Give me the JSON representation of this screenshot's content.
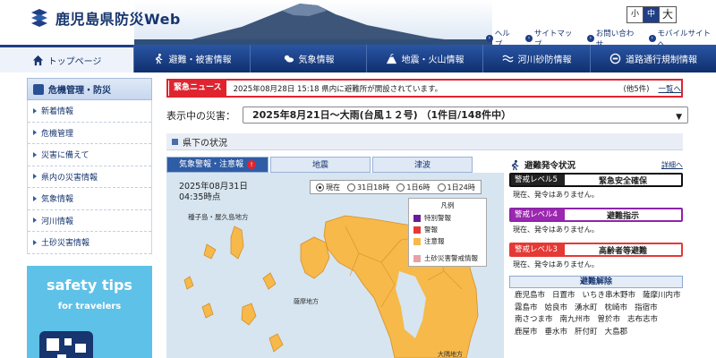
{
  "header": {
    "site_title": "鹿児島県防災Web",
    "font_size": {
      "small": "小",
      "medium": "中",
      "large": "大",
      "selected": "中"
    },
    "links": [
      "ヘルプ",
      "サイトマップ",
      "お問い合わせ",
      "モバイルサイトへ"
    ]
  },
  "nav": {
    "items": [
      {
        "label": "トップページ",
        "icon": "home-icon"
      },
      {
        "label": "避難・被害情報",
        "icon": "running-person-icon"
      },
      {
        "label": "気象情報",
        "icon": "weather-icon"
      },
      {
        "label": "地震・火山情報",
        "icon": "volcano-icon"
      },
      {
        "label": "河川砂防情報",
        "icon": "wave-icon"
      },
      {
        "label": "道路通行規制情報",
        "icon": "road-sign-icon"
      }
    ],
    "active_index": 0
  },
  "sidebar": {
    "heading": "危機管理・防災",
    "items": [
      "新着情報",
      "危機管理",
      "災害に備えて",
      "県内の災害情報",
      "気象情報",
      "河川情報",
      "土砂災害情報"
    ],
    "banner": {
      "line1": "safety tips",
      "line2": "for travelers"
    }
  },
  "news": {
    "tag": "緊急ニュース",
    "text": "2025年08月28日 15:18 県内に避難所が開設されています。",
    "count": "(他5件)",
    "more": "一覧へ"
  },
  "disaster_select": {
    "label": "表示中の災害：",
    "value": "2025年8月21日～大雨(台風１２号) （1件目/148件中）"
  },
  "section": {
    "title": "県下の状況"
  },
  "tabs": [
    {
      "label": "気象警報・注意報",
      "active": true
    },
    {
      "label": "地震",
      "active": false
    },
    {
      "label": "津波",
      "active": false
    }
  ],
  "map": {
    "datetime_line1": "2025年08月31日",
    "datetime_line2": "04:35時点",
    "time_options": [
      "現在",
      "31日18時",
      "1日6時",
      "1日24時"
    ],
    "time_selected": "現在",
    "legend": {
      "title": "凡例",
      "items": [
        {
          "label": "特別警報",
          "color": "#6a1b9a"
        },
        {
          "label": "警報",
          "color": "#e53935"
        },
        {
          "label": "注意報",
          "color": "#f6b94a"
        },
        {
          "label": "土砂災害警戒情報",
          "color": "#e8a1a8"
        }
      ]
    },
    "labels": {
      "islands": "種子島・屋久島地方",
      "satsuma": "薩摩地方",
      "osumi": "大隅地方"
    }
  },
  "evacuation": {
    "heading": "避難発令状況",
    "details_link": "詳細へ",
    "levels": [
      {
        "level": "警戒レベル5",
        "name": "緊急安全確保",
        "note": "現在、発令はありません。",
        "color": "#111111",
        "bg": "#222222"
      },
      {
        "level": "警戒レベル4",
        "name": "避難指示",
        "note": "現在、発令はありません。",
        "color": "#8e24aa",
        "bg": "#9c27b0"
      },
      {
        "level": "警戒レベル3",
        "name": "高齢者等避難",
        "note": "現在、発令はありません。",
        "color": "#e53935",
        "bg": "#e53935"
      }
    ],
    "lifted_heading": "避難解除",
    "lifted_cities": [
      "鹿児島市",
      "日置市",
      "いちき串木野市",
      "薩摩川内市",
      "霧島市",
      "姶良市",
      "湧水町",
      "枕崎市",
      "指宿市",
      "南さつま市",
      "南九州市",
      "曽於市",
      "志布志市",
      "鹿屋市",
      "垂水市",
      "肝付町",
      "大島郡"
    ]
  },
  "colors": {
    "brand": "#17356e",
    "nav": "#1f3f86",
    "alert": "#e0242f",
    "advisory": "#f6b94a",
    "sea": "#d6e5f0"
  }
}
